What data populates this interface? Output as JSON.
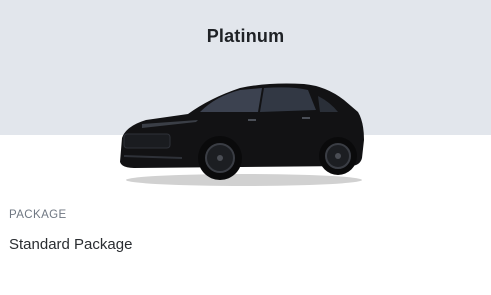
{
  "trim": {
    "name": "Platinum",
    "vehicle_image": "black-sedan-image",
    "vehicle_color": "#121214"
  },
  "package": {
    "label": "PACKAGE",
    "value": "Standard Package"
  },
  "colors": {
    "header_background": "#e2e6ec",
    "title_text": "#1f2226",
    "label_text": "#6f7782"
  }
}
